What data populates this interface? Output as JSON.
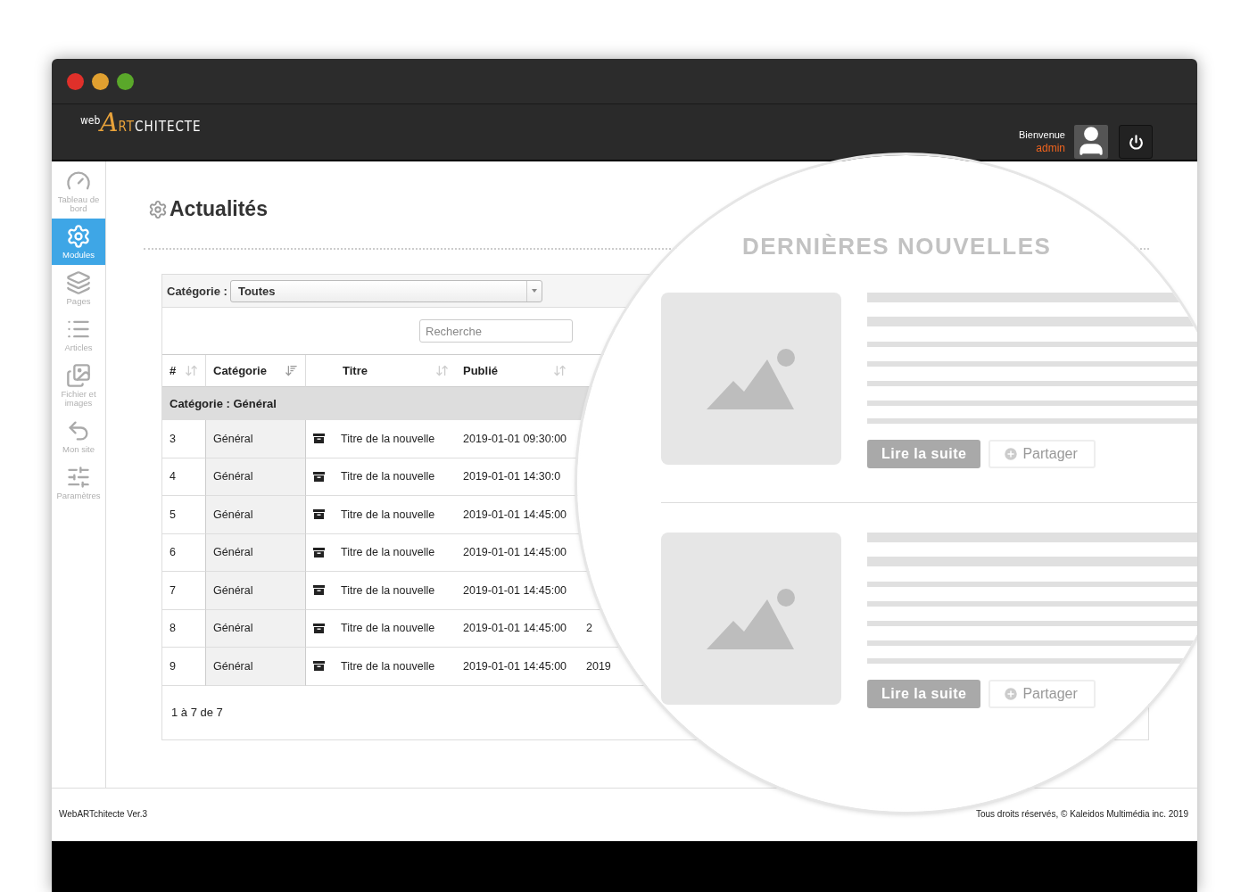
{
  "header": {
    "logo": {
      "prefix": "web",
      "initial": "A",
      "accent": "RT",
      "rest": "CHITECTE"
    },
    "welcome": "Bienvenue",
    "user": "admin"
  },
  "sidebar": {
    "items": [
      {
        "label": "Tableau de bord",
        "selected": false
      },
      {
        "label": "Modules",
        "selected": true
      },
      {
        "label": "Pages",
        "selected": false
      },
      {
        "label": "Articles",
        "selected": false
      },
      {
        "label": "Fichier et images",
        "selected": false
      },
      {
        "label": "Mon site",
        "selected": false
      },
      {
        "label": "Paramètres",
        "selected": false
      }
    ]
  },
  "page": {
    "title": "Actualités"
  },
  "filter": {
    "label": "Catégorie :",
    "value": "Toutes"
  },
  "search": {
    "placeholder": "Recherche"
  },
  "table": {
    "columns": [
      {
        "label": "#",
        "sorted": false
      },
      {
        "label": "Catégorie",
        "sorted": true
      },
      {
        "label": "Titre",
        "sorted": false
      },
      {
        "label": "Publié",
        "sorted": false
      }
    ],
    "group": "Catégorie : Général",
    "rows": [
      {
        "id": "3",
        "category": "Général",
        "title": "Titre de la nouvelle",
        "published": "2019-01-01 09:30:00"
      },
      {
        "id": "4",
        "category": "Général",
        "title": "Titre de la nouvelle",
        "published": "2019-01-01 14:30:0"
      },
      {
        "id": "5",
        "category": "Général",
        "title": "Titre de la nouvelle",
        "published": "2019-01-01 14:45:00"
      },
      {
        "id": "6",
        "category": "Général",
        "title": "Titre de la nouvelle",
        "published": "2019-01-01 14:45:00"
      },
      {
        "id": "7",
        "category": "Général",
        "title": "Titre de la nouvelle",
        "published": "2019-01-01 14:45:00"
      },
      {
        "id": "8",
        "category": "Général",
        "title": "Titre de la nouvelle",
        "published": "2019-01-01 14:45:00",
        "column_6": "2"
      },
      {
        "id": "9",
        "category": "Général",
        "title": "Titre de la nouvelle",
        "published": "2019-01-01 14:45:00",
        "column_6": "2019"
      }
    ],
    "pagination": "1 à 7 de 7"
  },
  "footer": {
    "left": "WebARTchitecte Ver.3",
    "right": "Tous droits réservés, © Kaleidos Multimédia inc. 2019"
  },
  "magnifier": {
    "title": "DERNIÈRES NOUVELLES",
    "items": [
      {
        "read_more": "Lire la suite",
        "share": "Partager"
      },
      {
        "read_more": "Lire la suite",
        "share": "Partager"
      }
    ]
  }
}
